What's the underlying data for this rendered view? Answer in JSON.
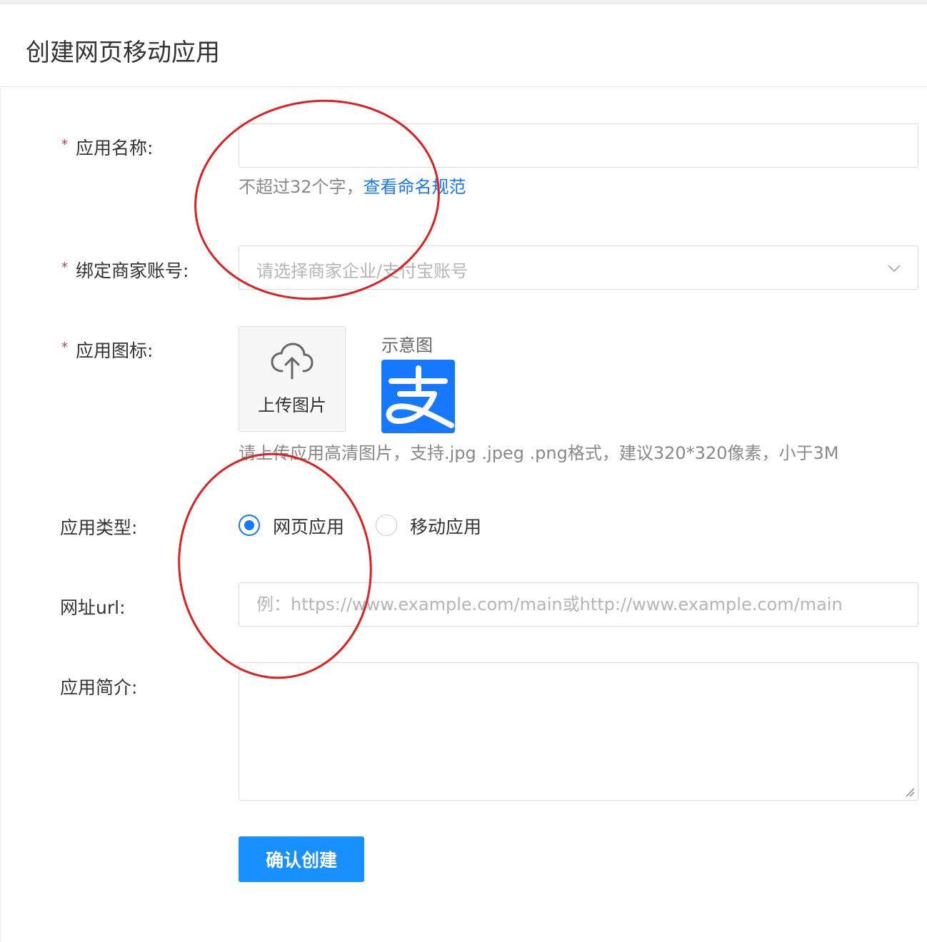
{
  "header": {
    "title": "创建网页移动应用"
  },
  "form": {
    "required_mark": "*",
    "app_name": {
      "label": "应用名称:",
      "value": "",
      "hint_prefix": "不超过32个字，",
      "hint_link": "查看命名规范"
    },
    "merchant_account": {
      "label": "绑定商家账号:",
      "placeholder": "请选择商家企业/支付宝账号"
    },
    "app_icon": {
      "label": "应用图标:",
      "upload_label": "上传图片",
      "sample_title": "示意图",
      "sample_glyph": "支",
      "hint": "请上传应用高清图片，支持.jpg .jpeg .png格式，建议320*320像素，小于3M"
    },
    "app_type": {
      "label": "应用类型:",
      "options": [
        {
          "label": "网页应用",
          "selected": true
        },
        {
          "label": "移动应用",
          "selected": false
        }
      ]
    },
    "url": {
      "label": "网址url:",
      "placeholder": "例：https://www.example.com/main或http://www.example.com/main"
    },
    "description": {
      "label": "应用简介:",
      "value": ""
    },
    "submit_label": "确认创建"
  },
  "colors": {
    "primary": "#1677ff",
    "button": "#1890ff",
    "required": "#e4393c",
    "annotation": "#e02020"
  }
}
